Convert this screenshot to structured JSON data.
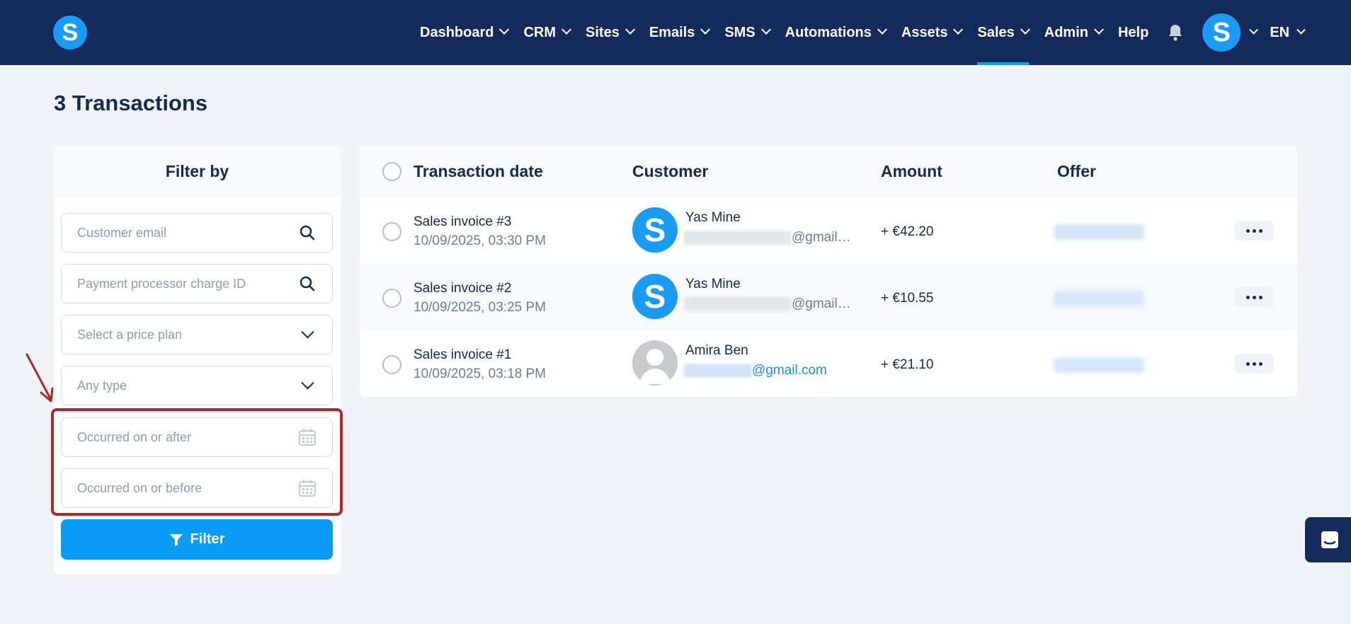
{
  "nav": {
    "items": [
      {
        "label": "Dashboard",
        "dropdown": true
      },
      {
        "label": "CRM",
        "dropdown": true
      },
      {
        "label": "Sites",
        "dropdown": true
      },
      {
        "label": "Emails",
        "dropdown": true
      },
      {
        "label": "SMS",
        "dropdown": true
      },
      {
        "label": "Automations",
        "dropdown": true
      },
      {
        "label": "Assets",
        "dropdown": true
      },
      {
        "label": "Sales",
        "dropdown": true,
        "active": true
      },
      {
        "label": "Admin",
        "dropdown": true
      },
      {
        "label": "Help",
        "dropdown": false
      }
    ],
    "logo_letter": "S",
    "avatar_letter": "S",
    "language": "EN"
  },
  "page": {
    "title": "3 Transactions"
  },
  "filter": {
    "heading": "Filter by",
    "customer_email_placeholder": "Customer email",
    "charge_id_placeholder": "Payment processor charge ID",
    "price_plan_placeholder": "Select a price plan",
    "type_placeholder": "Any type",
    "after_placeholder": "Occurred on or after",
    "before_placeholder": "Occurred on or before",
    "button_label": "Filter"
  },
  "table": {
    "headers": {
      "date": "Transaction date",
      "customer": "Customer",
      "amount": "Amount",
      "offer": "Offer"
    },
    "rows": [
      {
        "invoice": "Sales invoice #3",
        "date": "10/09/2025, 03:30 PM",
        "customer_name": "Yas Mine",
        "email_domain": "@gmail…",
        "amount": "+ €42.20",
        "avatar": "S"
      },
      {
        "invoice": "Sales invoice #2",
        "date": "10/09/2025, 03:25 PM",
        "customer_name": "Yas Mine",
        "email_domain": "@gmail…",
        "amount": "+ €10.55",
        "avatar": "S"
      },
      {
        "invoice": "Sales invoice #1",
        "date": "10/09/2025, 03:18 PM",
        "customer_name": "Amira Ben",
        "email_domain": "@gmail.com",
        "amount": "+ €21.10",
        "avatar": "person"
      }
    ]
  },
  "colors": {
    "nav_bg": "#142a5a",
    "accent": "#1a9bf5",
    "highlight": "#b0262b",
    "page_bg": "#f0f4f9"
  }
}
